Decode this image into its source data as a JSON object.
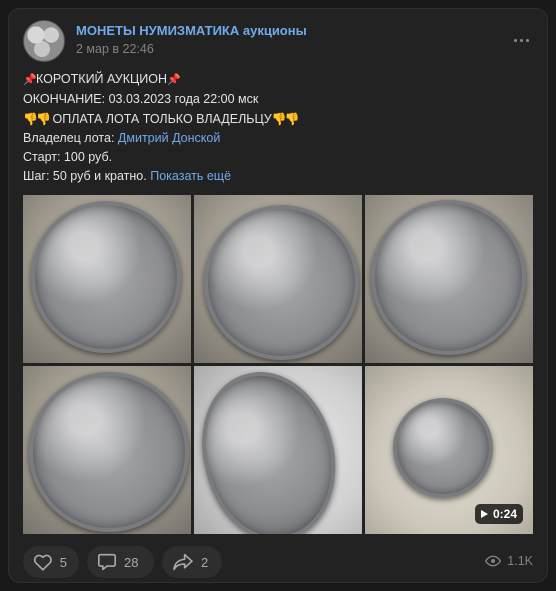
{
  "post": {
    "group_name": "МОНЕТЫ НУМИЗМАТИКА аукционы",
    "date": "2 мар в 22:46",
    "text": {
      "line1": "КОРОТКИЙ АУКЦИОН",
      "line2": "ОКОНЧАНИЕ: 03.03.2023 года 22:00 мск",
      "line3": "ОПЛАТА ЛОТА ТОЛЬКО ВЛАДЕЛЬЦУ",
      "owner_label": "Владелец лота:",
      "owner_name": "Дмитрий Донской",
      "start": "Старт: 100 руб.",
      "step": "Шаг: 50 руб и кратно.",
      "show_more": "Показать ещё"
    },
    "video_duration": "0:24",
    "actions": {
      "likes": "5",
      "comments": "28",
      "shares": "2",
      "views": "1.1K"
    }
  },
  "icons": {
    "pin": "pushpin-icon",
    "warning": "pointing-down-hand-icon",
    "more": "more-horizontal-icon",
    "like": "heart-icon",
    "comment": "comment-icon",
    "share": "share-icon",
    "views": "eye-icon",
    "play": "play-icon"
  },
  "colors": {
    "background": "#19191a",
    "card": "#222222",
    "link": "#71aaeb",
    "text": "#e1e3e6",
    "muted": "#828282"
  }
}
